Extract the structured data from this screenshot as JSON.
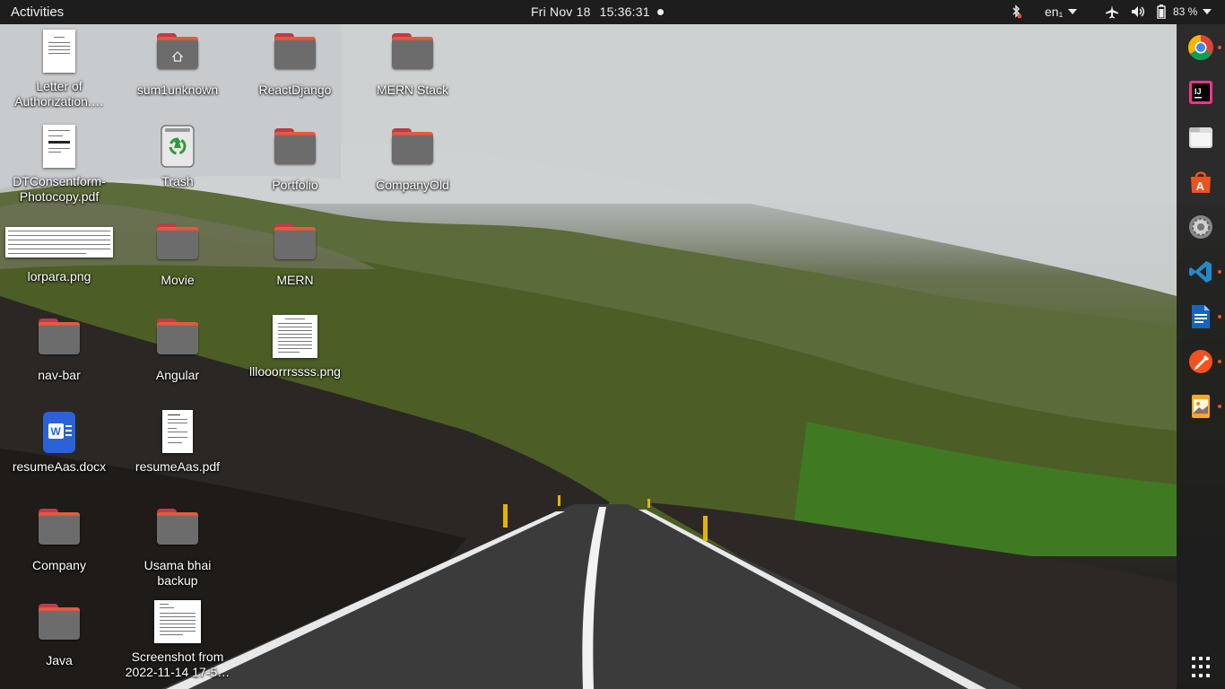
{
  "topbar": {
    "activities": "Activities",
    "date": "Fri Nov 18",
    "time": "15:36:31",
    "language": "en₁",
    "battery": "83 %"
  },
  "dock": {
    "apps": [
      {
        "icon": "chrome-icon",
        "running": true
      },
      {
        "icon": "intellij-icon",
        "running": false
      },
      {
        "icon": "files-icon",
        "running": false
      },
      {
        "icon": "software-store-icon",
        "running": false
      },
      {
        "icon": "settings-icon",
        "running": false
      },
      {
        "icon": "vscode-icon",
        "running": true
      },
      {
        "icon": "writer-icon",
        "running": true
      },
      {
        "icon": "color-picker-icon",
        "running": true
      },
      {
        "icon": "image-viewer-icon",
        "running": true
      }
    ]
  },
  "desktop": {
    "icons": [
      {
        "label": "Letter of Authorization.…",
        "type": "doc"
      },
      {
        "label": "sum1unknown",
        "type": "home-folder"
      },
      {
        "label": "ReactDjango",
        "type": "folder"
      },
      {
        "label": "MERN Stack",
        "type": "folder"
      },
      {
        "label": "DTConsentform-Photocopy.pdf",
        "type": "doc"
      },
      {
        "label": "Trash",
        "type": "trash"
      },
      {
        "label": "Portfolio",
        "type": "folder"
      },
      {
        "label": "CompanyOld",
        "type": "folder"
      },
      {
        "label": "lorpara.png",
        "type": "wide-image"
      },
      {
        "label": "Movie",
        "type": "folder"
      },
      {
        "label": "MERN",
        "type": "folder"
      },
      {
        "label": "nav-bar",
        "type": "folder"
      },
      {
        "label": "Angular",
        "type": "folder"
      },
      {
        "label": "lllooorrrssss.png",
        "type": "doc"
      },
      {
        "label": "resumeAas.docx",
        "type": "word"
      },
      {
        "label": "resumeAas.pdf",
        "type": "doc"
      },
      {
        "label": "Company",
        "type": "folder"
      },
      {
        "label": "Usama bhai backup",
        "type": "folder"
      },
      {
        "label": "Java",
        "type": "folder"
      },
      {
        "label": "Screenshot from 2022-11-14 17-5…",
        "type": "doc"
      }
    ]
  }
}
